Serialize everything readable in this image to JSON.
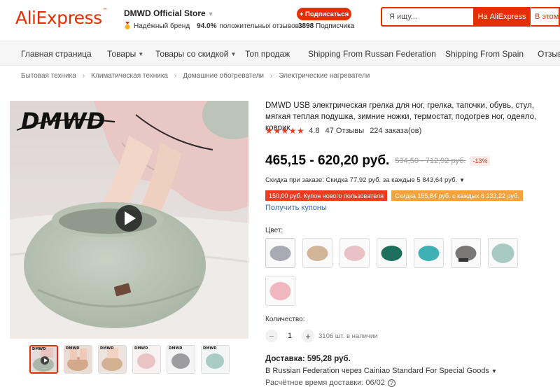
{
  "header": {
    "logo": "AliExpress",
    "store_name": "DMWD Official Store",
    "trusted_label": "Надёжный бренд",
    "positive_pct": "94.0%",
    "positive_label": "положительных отзывов",
    "subscribe_label": "+ Подписаться",
    "subscribers_count": "3898",
    "subscribers_label": "Подписчика",
    "search_placeholder": "Я ищу...",
    "search_button": "На AliExpress",
    "search_button2": "В этом магазине"
  },
  "nav": {
    "items": [
      {
        "label": "Главная страница"
      },
      {
        "label": "Товары"
      },
      {
        "label": "Товары со скидкой"
      },
      {
        "label": "Топ продаж"
      },
      {
        "label": "Shipping From Russan Federation"
      },
      {
        "label": "Shipping From Spain"
      },
      {
        "label": "Отзывы"
      }
    ]
  },
  "breadcrumb": [
    "Бытовая техника",
    "Климатическая техника",
    "Домашние обогреватели",
    "Электрические нагреватели"
  ],
  "gallery": {
    "brand_watermark": "DMWD",
    "thumb_count": 6
  },
  "product": {
    "title": "DMWD USB электрическая грелка для ног, грелка, тапочки, обувь, стул, мягкая теплая подушка, зимние ножки, термостат, подогрев ног, одеяло, коврик",
    "stars": "★★★★★",
    "rating": "4.8",
    "reviews": "47 Отзывы",
    "orders": "224 заказа(ов)",
    "price": "465,15 - 620,20 руб.",
    "old_price": "534,50 - 712,92 руб.",
    "discount": "-13%",
    "order_discount": "Скидка при заказе: Скидка 77,92 руб. за каждые 5 843,64 руб.",
    "coupon_new_user": "150,00 руб. Купон нового пользователя",
    "coupon_store": "Скидка 155,84 руб. с каждых 6 233,22 руб.",
    "get_coupons": "Получить купоны",
    "color_label": "Цвет:",
    "swatch_colors": [
      "#a9aab3",
      "#d2b497",
      "#e8c2c4",
      "#1f6f5e",
      "#3fb0b3",
      "#7a7777",
      "#a9c9c3",
      "#f1b7bf"
    ],
    "quantity_label": "Количество:",
    "quantity_minus": "−",
    "quantity_value": "1",
    "quantity_plus": "+",
    "stock": "3106 шт. в наличии",
    "shipping": "Доставка: 595,28 руб.",
    "shipping_method": "В Russian Federation через Cainiao Standard For Special Goods",
    "delivery_time": "Расчётное время доставки: 06/02"
  },
  "colors": {
    "accent": "#e62e04",
    "star": "#ee3a1f",
    "link": "#2b6ac4",
    "coupon_orange": "#f6a23c"
  }
}
